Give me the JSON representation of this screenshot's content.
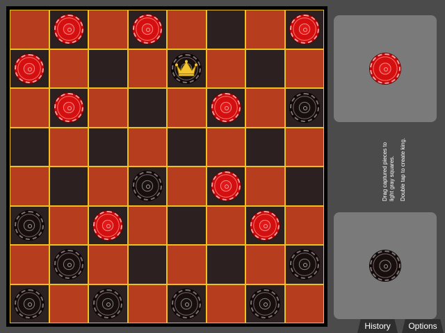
{
  "board": {
    "rows": [
      [
        "",
        "r",
        "",
        "r",
        "",
        "",
        "",
        "r"
      ],
      [
        "r",
        "",
        "",
        "",
        "bk",
        "",
        "",
        ""
      ],
      [
        "",
        "r",
        "",
        "",
        "",
        "r",
        "",
        "b"
      ],
      [
        "",
        "",
        "",
        "",
        "",
        "",
        "",
        ""
      ],
      [
        "",
        "",
        "",
        "b",
        "",
        "r",
        "",
        ""
      ],
      [
        "b",
        "",
        "r",
        "",
        "",
        "",
        "r",
        ""
      ],
      [
        "",
        "b",
        "",
        "",
        "",
        "",
        "",
        "b"
      ],
      [
        "b",
        "",
        "b",
        "",
        "b",
        "",
        "b",
        ""
      ]
    ],
    "colors": {
      "light_square": "#b63d1e",
      "dark_square": "#2c2020",
      "grid_lines": "#f0c020",
      "red_piece": "#d40f0f",
      "black_piece": "#180e0e",
      "crown": "#f4c430"
    }
  },
  "side_panel": {
    "top_captured": "r",
    "bottom_captured": "b",
    "instructions": [
      "Drag captured pieces to",
      "light gray squares.",
      "Double tap to create king."
    ]
  },
  "tabs": {
    "history": "History",
    "options": "Options"
  }
}
